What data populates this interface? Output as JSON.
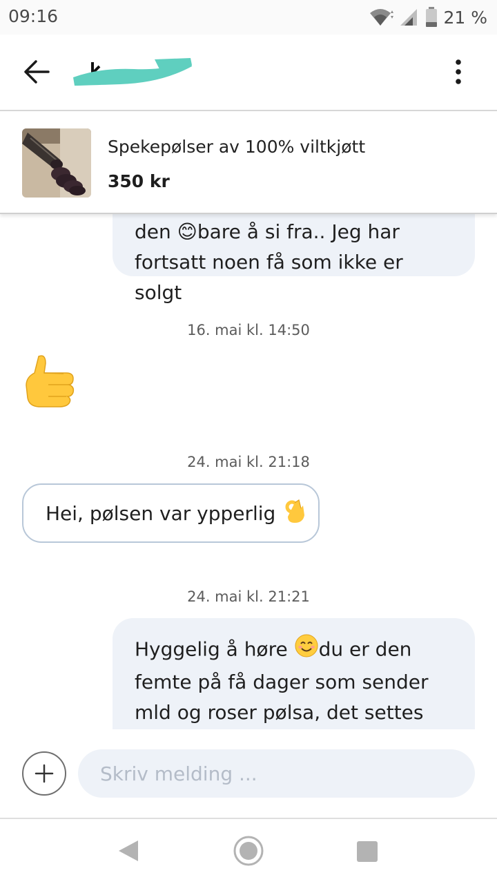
{
  "status_bar": {
    "time": "09:16",
    "battery_percent": "21 %"
  },
  "header": {
    "contact_name": "",
    "back_icon": "arrow-left-icon",
    "menu_icon": "vertical-dots-icon"
  },
  "product": {
    "title": "Spekepølser av 100% viltkjøtt",
    "price": "350 kr"
  },
  "messages": {
    "m1_partial_top": "den 😊bare å si fra.. Jeg har",
    "m1_line2": "fortsatt noen få som ikke er solgt",
    "ts1": "16. mai kl. 14:50",
    "m2_emoji": "👍",
    "ts2": "24. mai kl. 21:18",
    "m3_text": "Hei, pølsen var ypperlig",
    "m3_emoji": "👌",
    "ts3": "24. mai kl. 21:21",
    "m4_text_a": "Hyggelig å høre",
    "m4_text_b": "du er den femte på få dager som sender mld og roser pølsa, det settes jeg"
  },
  "composer": {
    "placeholder": "Skriv melding ..."
  },
  "colors": {
    "accent_redaction": "#5fcfbf",
    "outgoing_bubble": "#eef2f8",
    "incoming_border": "#b8c7d8"
  }
}
